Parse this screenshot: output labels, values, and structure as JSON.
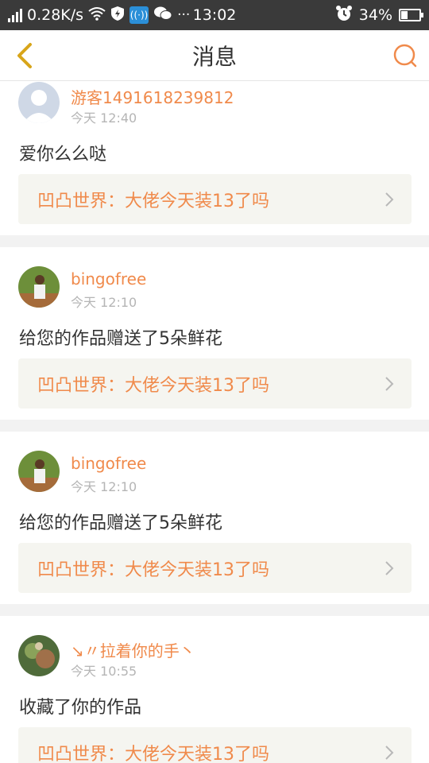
{
  "status_bar": {
    "network_speed": "0.28K/s",
    "time": "13:02",
    "battery": "34%",
    "battery_level": 0.34,
    "icons": [
      "signal-icon",
      "wifi-icon",
      "shield-icon",
      "hotspot-icon",
      "wechat-icon",
      "more-icon",
      "alarm-icon",
      "battery-icon"
    ]
  },
  "header": {
    "title": "消息",
    "back_icon": "chevron-left-icon",
    "search_icon": "search-icon",
    "accent_color": "#f08a4b"
  },
  "messages": [
    {
      "user": "游客1491618239812",
      "time": "今天 12:40",
      "text": "爱你么么哒",
      "work": "凹凸世界：大佬今天装13了吗",
      "avatar": "default-avatar"
    },
    {
      "user": "bingofree",
      "time": "今天 12:10",
      "text": "给您的作品赠送了5朵鲜花",
      "work": "凹凸世界：大佬今天装13了吗",
      "avatar": "photo-avatar"
    },
    {
      "user": "bingofree",
      "time": "今天 12:10",
      "text": "给您的作品赠送了5朵鲜花",
      "work": "凹凸世界：大佬今天装13了吗",
      "avatar": "photo-avatar"
    },
    {
      "user": "↘〃拉着你的手丶",
      "time": "今天 10:55",
      "text": "收藏了你的作品",
      "work": "凹凸世界：大佬今天装13了吗",
      "avatar": "photo-avatar-2"
    }
  ]
}
